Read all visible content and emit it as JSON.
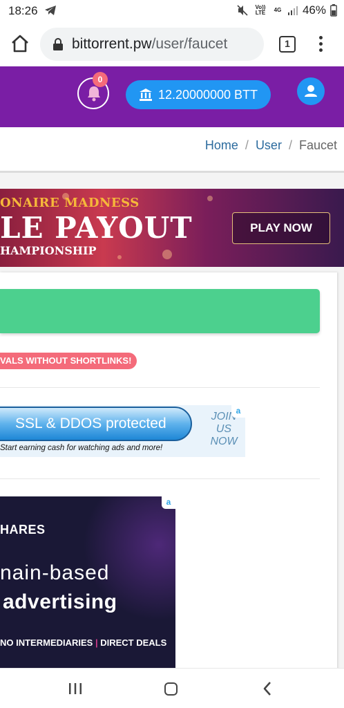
{
  "status_bar": {
    "time": "18:26",
    "volte": "Vo)) LTE",
    "network": "4G",
    "battery": "46%"
  },
  "browser": {
    "domain": "bittorrent.pw",
    "path": "/user/faucet",
    "tab_count": "1"
  },
  "header": {
    "notification_count": "0",
    "balance": "12.20000000 BTT"
  },
  "breadcrumb": {
    "items": [
      "Home",
      "User",
      "Faucet"
    ],
    "separator": "/"
  },
  "banner_ad": {
    "line1": "ONAIRE MADNESS",
    "line2": "LE PAYOUT",
    "line3": "HAMPIONSHIP",
    "cta": "PLAY NOW"
  },
  "faucet": {
    "notice_badge": "VALS WITHOUT SHORTLINKS!"
  },
  "ad_ssl": {
    "headline": "SSL & DDOS protected",
    "subline": "Start earning cash for watching ads and more!",
    "join": [
      "JOIN",
      "US",
      "NOW"
    ],
    "badge": "a"
  },
  "ad_shares": {
    "line1": "HARES",
    "line2": "nain-based",
    "line3": "advertising",
    "tagline_left": "NO INTERMEDIARIES",
    "tagline_sep": "|",
    "tagline_right": "DIRECT DEALS",
    "badge": "a"
  },
  "colors": {
    "header_purple": "#7a1ea5",
    "button_blue": "#2196f3",
    "success_green": "#4cd08e",
    "badge_red": "#f46b7a"
  }
}
